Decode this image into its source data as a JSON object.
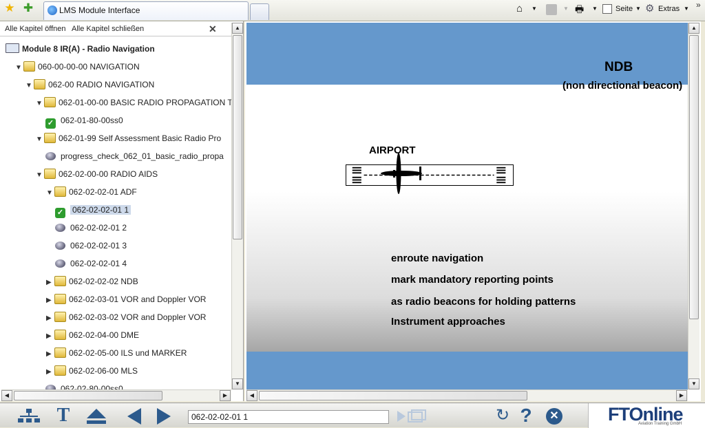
{
  "browser": {
    "tab_title": "LMS Module Interface",
    "toolbar": {
      "page_label": "Seite",
      "extras_label": "Extras"
    }
  },
  "sidebar": {
    "open_all": "Alle Kapitel öffnen",
    "close_all": "Alle Kapitel schließen",
    "close_symbol": "✕",
    "tree": [
      {
        "label": "Module 8 IR(A) - Radio Navigation",
        "icon": "book",
        "arrow": ""
      },
      {
        "label": "060-00-00-00 NAVIGATION",
        "icon": "folder",
        "arrow": "▼"
      },
      {
        "label": "062-00 RADIO NAVIGATION",
        "icon": "folder",
        "arrow": "▼"
      },
      {
        "label": "062-01-00-00 BASIC RADIO PROPAGATION T",
        "icon": "folder",
        "arrow": "▼"
      },
      {
        "label": "062-01-80-00ss0",
        "icon": "check",
        "arrow": ""
      },
      {
        "label": "062-01-99 Self Assessment Basic Radio Pro",
        "icon": "folder",
        "arrow": "▼"
      },
      {
        "label": "progress_check_062_01_basic_radio_propa",
        "icon": "disc",
        "arrow": ""
      },
      {
        "label": "062-02-00-00 RADIO AIDS",
        "icon": "folder",
        "arrow": "▼"
      },
      {
        "label": "062-02-02-01 ADF",
        "icon": "folder",
        "arrow": "▼"
      },
      {
        "label": "062-02-02-01 1",
        "icon": "check",
        "arrow": "",
        "selected": true
      },
      {
        "label": "062-02-02-01 2",
        "icon": "disc",
        "arrow": ""
      },
      {
        "label": "062-02-02-01 3",
        "icon": "disc",
        "arrow": ""
      },
      {
        "label": "062-02-02-01 4",
        "icon": "disc",
        "arrow": ""
      },
      {
        "label": "062-02-02-02 NDB",
        "icon": "folder",
        "arrow": "▶"
      },
      {
        "label": "062-02-03-01 VOR and Doppler VOR",
        "icon": "folder",
        "arrow": "▶"
      },
      {
        "label": "062-02-03-02 VOR and Doppler VOR",
        "icon": "folder",
        "arrow": "▶"
      },
      {
        "label": "062-02-04-00 DME",
        "icon": "folder",
        "arrow": "▶"
      },
      {
        "label": "062-02-05-00 ILS und MARKER",
        "icon": "folder",
        "arrow": "▶"
      },
      {
        "label": "062-02-06-00 MLS",
        "icon": "folder",
        "arrow": "▶"
      },
      {
        "label": "062-02-80-00ss0",
        "icon": "disc",
        "arrow": ""
      }
    ]
  },
  "slide": {
    "title": "NDB",
    "subtitle": "(non directional beacon)",
    "diagram_label": "AIRPORT",
    "bullets": [
      "enroute navigation",
      "mark mandatory reporting points",
      "as radio beacons for holding patterns",
      "Instrument approaches"
    ],
    "colors": {
      "band": "#6598cc"
    }
  },
  "bottom": {
    "current_page": "062-02-02-01 1",
    "logo_text": "FTOnline",
    "logo_sub": "Aviation Training GmbH"
  }
}
